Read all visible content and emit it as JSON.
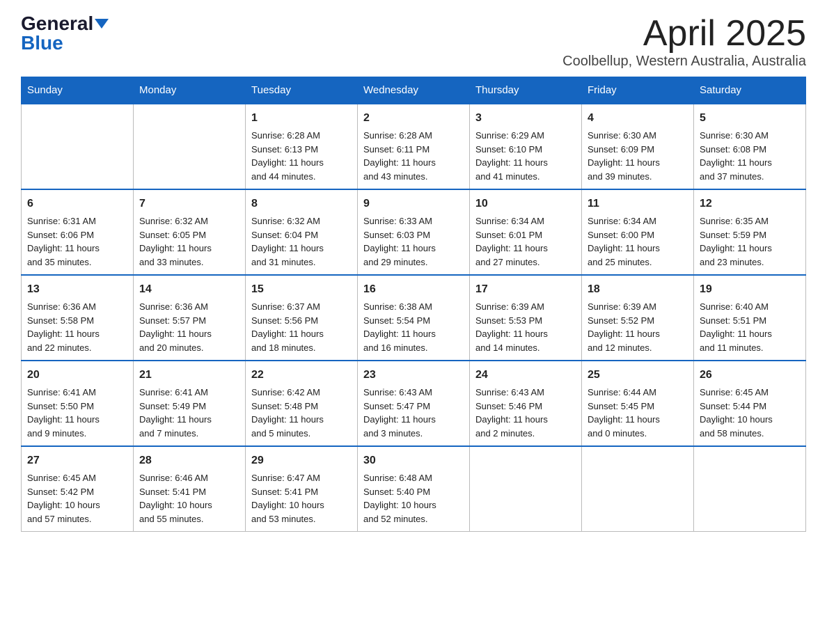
{
  "logo": {
    "general": "General",
    "blue": "Blue"
  },
  "title": "April 2025",
  "subtitle": "Coolbellup, Western Australia, Australia",
  "days_of_week": [
    "Sunday",
    "Monday",
    "Tuesday",
    "Wednesday",
    "Thursday",
    "Friday",
    "Saturday"
  ],
  "weeks": [
    [
      {
        "day": "",
        "info": ""
      },
      {
        "day": "",
        "info": ""
      },
      {
        "day": "1",
        "info": "Sunrise: 6:28 AM\nSunset: 6:13 PM\nDaylight: 11 hours\nand 44 minutes."
      },
      {
        "day": "2",
        "info": "Sunrise: 6:28 AM\nSunset: 6:11 PM\nDaylight: 11 hours\nand 43 minutes."
      },
      {
        "day": "3",
        "info": "Sunrise: 6:29 AM\nSunset: 6:10 PM\nDaylight: 11 hours\nand 41 minutes."
      },
      {
        "day": "4",
        "info": "Sunrise: 6:30 AM\nSunset: 6:09 PM\nDaylight: 11 hours\nand 39 minutes."
      },
      {
        "day": "5",
        "info": "Sunrise: 6:30 AM\nSunset: 6:08 PM\nDaylight: 11 hours\nand 37 minutes."
      }
    ],
    [
      {
        "day": "6",
        "info": "Sunrise: 6:31 AM\nSunset: 6:06 PM\nDaylight: 11 hours\nand 35 minutes."
      },
      {
        "day": "7",
        "info": "Sunrise: 6:32 AM\nSunset: 6:05 PM\nDaylight: 11 hours\nand 33 minutes."
      },
      {
        "day": "8",
        "info": "Sunrise: 6:32 AM\nSunset: 6:04 PM\nDaylight: 11 hours\nand 31 minutes."
      },
      {
        "day": "9",
        "info": "Sunrise: 6:33 AM\nSunset: 6:03 PM\nDaylight: 11 hours\nand 29 minutes."
      },
      {
        "day": "10",
        "info": "Sunrise: 6:34 AM\nSunset: 6:01 PM\nDaylight: 11 hours\nand 27 minutes."
      },
      {
        "day": "11",
        "info": "Sunrise: 6:34 AM\nSunset: 6:00 PM\nDaylight: 11 hours\nand 25 minutes."
      },
      {
        "day": "12",
        "info": "Sunrise: 6:35 AM\nSunset: 5:59 PM\nDaylight: 11 hours\nand 23 minutes."
      }
    ],
    [
      {
        "day": "13",
        "info": "Sunrise: 6:36 AM\nSunset: 5:58 PM\nDaylight: 11 hours\nand 22 minutes."
      },
      {
        "day": "14",
        "info": "Sunrise: 6:36 AM\nSunset: 5:57 PM\nDaylight: 11 hours\nand 20 minutes."
      },
      {
        "day": "15",
        "info": "Sunrise: 6:37 AM\nSunset: 5:56 PM\nDaylight: 11 hours\nand 18 minutes."
      },
      {
        "day": "16",
        "info": "Sunrise: 6:38 AM\nSunset: 5:54 PM\nDaylight: 11 hours\nand 16 minutes."
      },
      {
        "day": "17",
        "info": "Sunrise: 6:39 AM\nSunset: 5:53 PM\nDaylight: 11 hours\nand 14 minutes."
      },
      {
        "day": "18",
        "info": "Sunrise: 6:39 AM\nSunset: 5:52 PM\nDaylight: 11 hours\nand 12 minutes."
      },
      {
        "day": "19",
        "info": "Sunrise: 6:40 AM\nSunset: 5:51 PM\nDaylight: 11 hours\nand 11 minutes."
      }
    ],
    [
      {
        "day": "20",
        "info": "Sunrise: 6:41 AM\nSunset: 5:50 PM\nDaylight: 11 hours\nand 9 minutes."
      },
      {
        "day": "21",
        "info": "Sunrise: 6:41 AM\nSunset: 5:49 PM\nDaylight: 11 hours\nand 7 minutes."
      },
      {
        "day": "22",
        "info": "Sunrise: 6:42 AM\nSunset: 5:48 PM\nDaylight: 11 hours\nand 5 minutes."
      },
      {
        "day": "23",
        "info": "Sunrise: 6:43 AM\nSunset: 5:47 PM\nDaylight: 11 hours\nand 3 minutes."
      },
      {
        "day": "24",
        "info": "Sunrise: 6:43 AM\nSunset: 5:46 PM\nDaylight: 11 hours\nand 2 minutes."
      },
      {
        "day": "25",
        "info": "Sunrise: 6:44 AM\nSunset: 5:45 PM\nDaylight: 11 hours\nand 0 minutes."
      },
      {
        "day": "26",
        "info": "Sunrise: 6:45 AM\nSunset: 5:44 PM\nDaylight: 10 hours\nand 58 minutes."
      }
    ],
    [
      {
        "day": "27",
        "info": "Sunrise: 6:45 AM\nSunset: 5:42 PM\nDaylight: 10 hours\nand 57 minutes."
      },
      {
        "day": "28",
        "info": "Sunrise: 6:46 AM\nSunset: 5:41 PM\nDaylight: 10 hours\nand 55 minutes."
      },
      {
        "day": "29",
        "info": "Sunrise: 6:47 AM\nSunset: 5:41 PM\nDaylight: 10 hours\nand 53 minutes."
      },
      {
        "day": "30",
        "info": "Sunrise: 6:48 AM\nSunset: 5:40 PM\nDaylight: 10 hours\nand 52 minutes."
      },
      {
        "day": "",
        "info": ""
      },
      {
        "day": "",
        "info": ""
      },
      {
        "day": "",
        "info": ""
      }
    ]
  ]
}
